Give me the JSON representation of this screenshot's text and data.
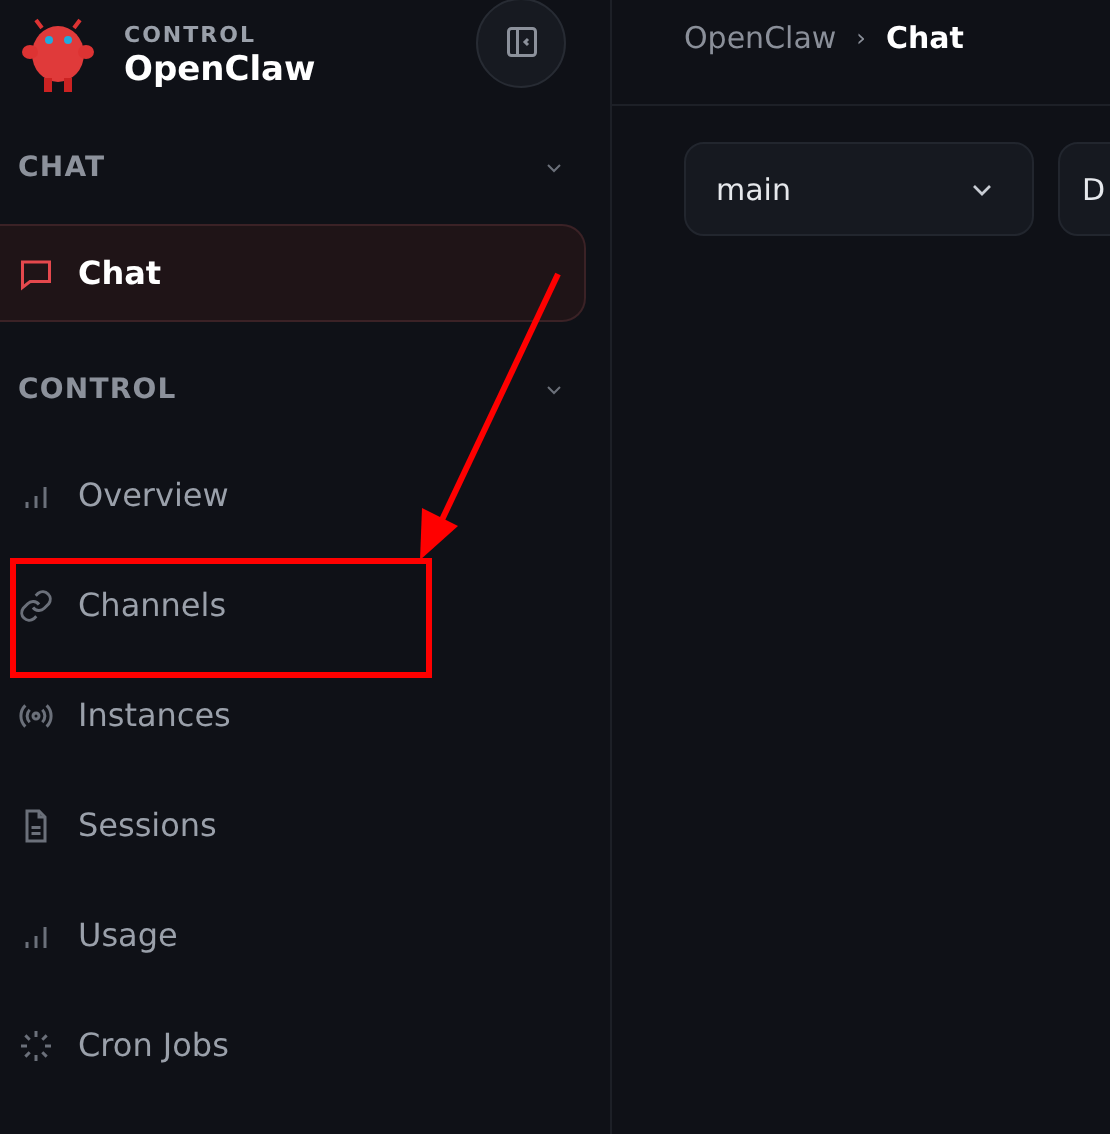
{
  "brand": {
    "label": "CONTROL",
    "name": "OpenClaw"
  },
  "nav_groups": [
    {
      "title": "CHAT",
      "expanded": true,
      "items": [
        {
          "label": "Chat",
          "selected": true
        }
      ]
    },
    {
      "title": "CONTROL",
      "expanded": true,
      "items": [
        {
          "label": "Overview",
          "selected": false
        },
        {
          "label": "Channels",
          "selected": false
        },
        {
          "label": "Instances",
          "selected": false
        },
        {
          "label": "Sessions",
          "selected": false
        },
        {
          "label": "Usage",
          "selected": false
        },
        {
          "label": "Cron Jobs",
          "selected": false
        }
      ]
    }
  ],
  "breadcrumb": [
    "OpenClaw",
    "Chat"
  ],
  "breadcrumb_separator": "›",
  "selects": [
    {
      "value": "main"
    },
    {
      "value": "D"
    }
  ]
}
